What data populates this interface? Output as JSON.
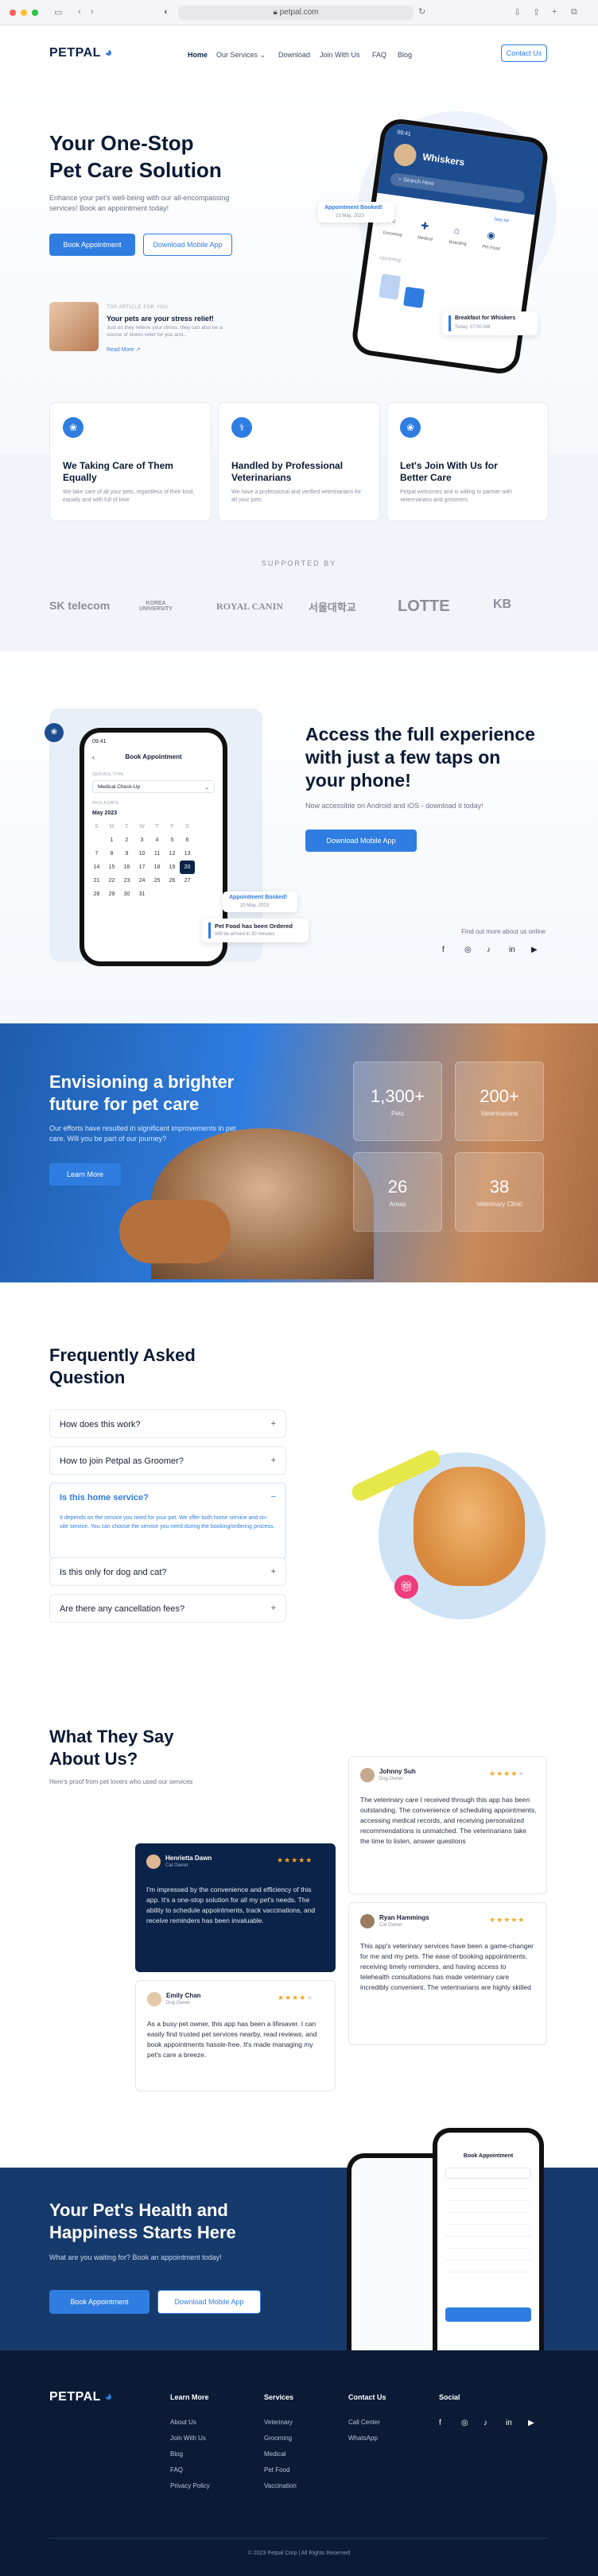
{
  "browser": {
    "url": "petpal.com"
  },
  "nav": {
    "logo": "PETPAL",
    "links": [
      "Home",
      "Our Services",
      "Download",
      "Join With Us",
      "FAQ",
      "Blog"
    ],
    "contact": "Contact Us"
  },
  "hero": {
    "title_1": "Your One-Stop",
    "title_2": "Pet Care Solution",
    "desc": "Enhance your pet's well-being with our all-encompassing services! Book an appointment today!",
    "btn_book": "Book Appointment",
    "btn_download": "Download Mobile App",
    "article": {
      "tag": "TOP ARTICLE FOR YOU",
      "title": "Your pets are your stress relief!",
      "desc": "Just as they relieve your stress, they can also be a source of stress relief for you and...",
      "read": "Read More"
    },
    "phone": {
      "time": "09:41",
      "pet": "Whiskers",
      "badge": "Appointment Booked!",
      "badge_date": "23 May, 2023",
      "search": "Search Here",
      "cat1": "Grooming",
      "cat2": "Medical",
      "cat3": "Boarding",
      "cat4": "Pet Food",
      "see_all": "See All",
      "section": "Upcoming",
      "breakfast": "Breakfast for Whiskers",
      "breakfast_time": "Today, 07:00 AM"
    }
  },
  "features": [
    {
      "icon": "paw-icon",
      "title": "We Taking Care of Them Equally",
      "desc": "We take care of all your pets, regardless of their kind, equally and with full of love"
    },
    {
      "icon": "stethoscope-icon",
      "title": "Handled by Professional Veterinarians",
      "desc": "We have a professional and verified veterinarians for all your pets"
    },
    {
      "icon": "paw-icon",
      "title": "Let's Join With Us for Better Care",
      "desc": "Petpal welcomes and is willing to partner with veterinarians and groomers"
    }
  ],
  "partners": {
    "label": "SUPPORTED BY",
    "brands": [
      "SK telecom",
      "KOREA UNIVERSITY",
      "ROYAL CANIN",
      "서울대학교",
      "LOTTE",
      "KB"
    ]
  },
  "app": {
    "title": "Access the full experience with just a few taps on your phone!",
    "desc": "Now accessible on Android and iOS - download it today!",
    "btn": "Download Mobile App",
    "follow": "Find out more about us online",
    "phone": {
      "time": "09:41",
      "title": "Book Appointment",
      "service_label": "SERVICE TYPE",
      "service": "Medical Check-Up",
      "date_label": "PICK A DATE",
      "month": "May 2023",
      "days": [
        "S",
        "M",
        "T",
        "W",
        "T",
        "F",
        "S"
      ],
      "badge": "Appointment Booked!",
      "badge_date": "20 May, 2023",
      "notif": "Pet Food has been Ordered",
      "notif_sub": "Will be arrived in 30 minutes"
    }
  },
  "future": {
    "title": "Envisioning a brighter future for pet care",
    "desc": "Our efforts have resulted in significant improvements in pet care. Will you be part of our journey?",
    "btn": "Learn More",
    "stats": [
      {
        "n": "1,300+",
        "l": "Pets"
      },
      {
        "n": "200+",
        "l": "Veterinarians"
      },
      {
        "n": "26",
        "l": "Areas"
      },
      {
        "n": "38",
        "l": "Veterinary Clinic"
      }
    ]
  },
  "faq": {
    "title": "Frequently Asked Question",
    "items": [
      {
        "q": "How does this work?"
      },
      {
        "q": "How to join Petpal as Groomer?"
      },
      {
        "q": "Is this home service?",
        "a": "It depends on the service you need for your pet. We offer both home service and on-site service. You can choose the service you need during the booking/ordering process."
      },
      {
        "q": "Is this only for dog and cat?"
      },
      {
        "q": "Are there any cancellation fees?"
      }
    ]
  },
  "testimonials": {
    "title": "What They Say About Us?",
    "desc": "Here's proof from pet lovers who used our services",
    "items": [
      {
        "name": "Johnny Suh",
        "role": "Dog Owner",
        "text": "The veterinary care I received through this app has been outstanding. The convenience of scheduling appointments, accessing medical records, and receiving personalized recommendations is unmatched. The veterinarians take the time to listen, answer questions"
      },
      {
        "name": "Henrietta Dawn",
        "role": "Cat Owner",
        "text": "I'm impressed by the convenience and efficiency of this app. It's a one-stop solution for all my pet's needs. The ability to schedule appointments, track vaccinations, and receive reminders has been invaluable."
      },
      {
        "name": "Ryan Hammings",
        "role": "Cat Owner",
        "text": "This app's veterinary services have been a game-changer for me and my pets. The ease of booking appointments, receiving timely reminders, and having access to telehealth consultations has made veterinary care incredibly convenient. The veterinarians are highly skilled"
      },
      {
        "name": "Emily Chan",
        "role": "Dog Owner",
        "text": "As a busy pet owner, this app has been a lifesaver. I can easily find trusted pet services nearby, read reviews, and book appointments hassle-free. It's made managing my pet's care a breeze."
      }
    ]
  },
  "cta": {
    "title_1": "Your Pet's Health and",
    "title_2": "Happiness Starts Here",
    "desc": "What are you waiting for? Book an appointment today!",
    "btn_book": "Book Appointment",
    "btn_download": "Download Mobile App",
    "phone_title": "Book Appointment"
  },
  "footer": {
    "logo": "PETPAL",
    "cols": [
      {
        "h": "Learn More",
        "links": [
          "About Us",
          "Join With Us",
          "Blog",
          "FAQ",
          "Privacy Policy"
        ]
      },
      {
        "h": "Services",
        "links": [
          "Veterinary",
          "Grooming",
          "Medical",
          "Pet Food",
          "Vaccination"
        ]
      },
      {
        "h": "Contact Us",
        "links": [
          "Call Center",
          "WhatsApp"
        ]
      },
      {
        "h": "Social",
        "links": []
      }
    ],
    "copy": "© 2023 Petpal Corp | All Rights Reserved"
  },
  "colors": {
    "primary": "#2f7de1",
    "navy": "#0b2348",
    "cta_bg": "#163a6b",
    "footer_bg": "#0b1b36"
  }
}
